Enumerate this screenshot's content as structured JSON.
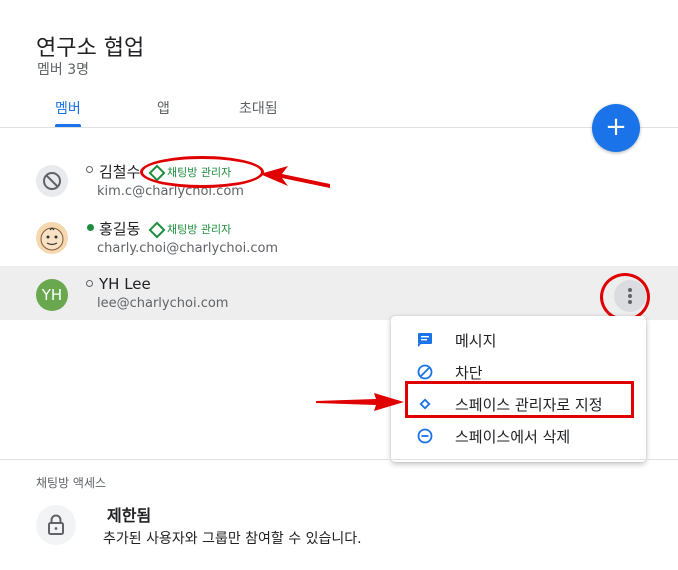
{
  "header": {
    "title": "연구소 협업",
    "subtitle": "멤버 3명"
  },
  "tabs": [
    {
      "label": "멤버",
      "active": true
    },
    {
      "label": "앱",
      "active": false
    },
    {
      "label": "초대됨",
      "active": false
    }
  ],
  "fab": {
    "label": "+"
  },
  "members": [
    {
      "name": "김철수",
      "email": "kim.c@charlychoi.com",
      "badge": "채팅방 관리자",
      "status": "offline"
    },
    {
      "name": "홍길동",
      "email": "charly.choi@charlychoi.com",
      "badge": "채팅방 관리자",
      "status": "online"
    },
    {
      "name": "YH Lee",
      "email": "lee@charlychoi.com",
      "initials": "YH",
      "status": "offline"
    }
  ],
  "context_menu": {
    "items": [
      {
        "label": "메시지",
        "icon": "message-icon"
      },
      {
        "label": "차단",
        "icon": "block-icon"
      },
      {
        "label": "스페이스 관리자로 지정",
        "icon": "diamond-icon"
      },
      {
        "label": "스페이스에서 삭제",
        "icon": "remove-circle-icon"
      }
    ]
  },
  "access": {
    "section_label": "채팅방 액세스",
    "title": "제한됨",
    "description": "추가된 사용자와 그룹만 참여할 수 있습니다."
  },
  "colors": {
    "accent": "#1a73e8",
    "badge_green": "#1e8e3e",
    "annotation_red": "#e00000",
    "avatar_yh": "#6aa84f"
  }
}
